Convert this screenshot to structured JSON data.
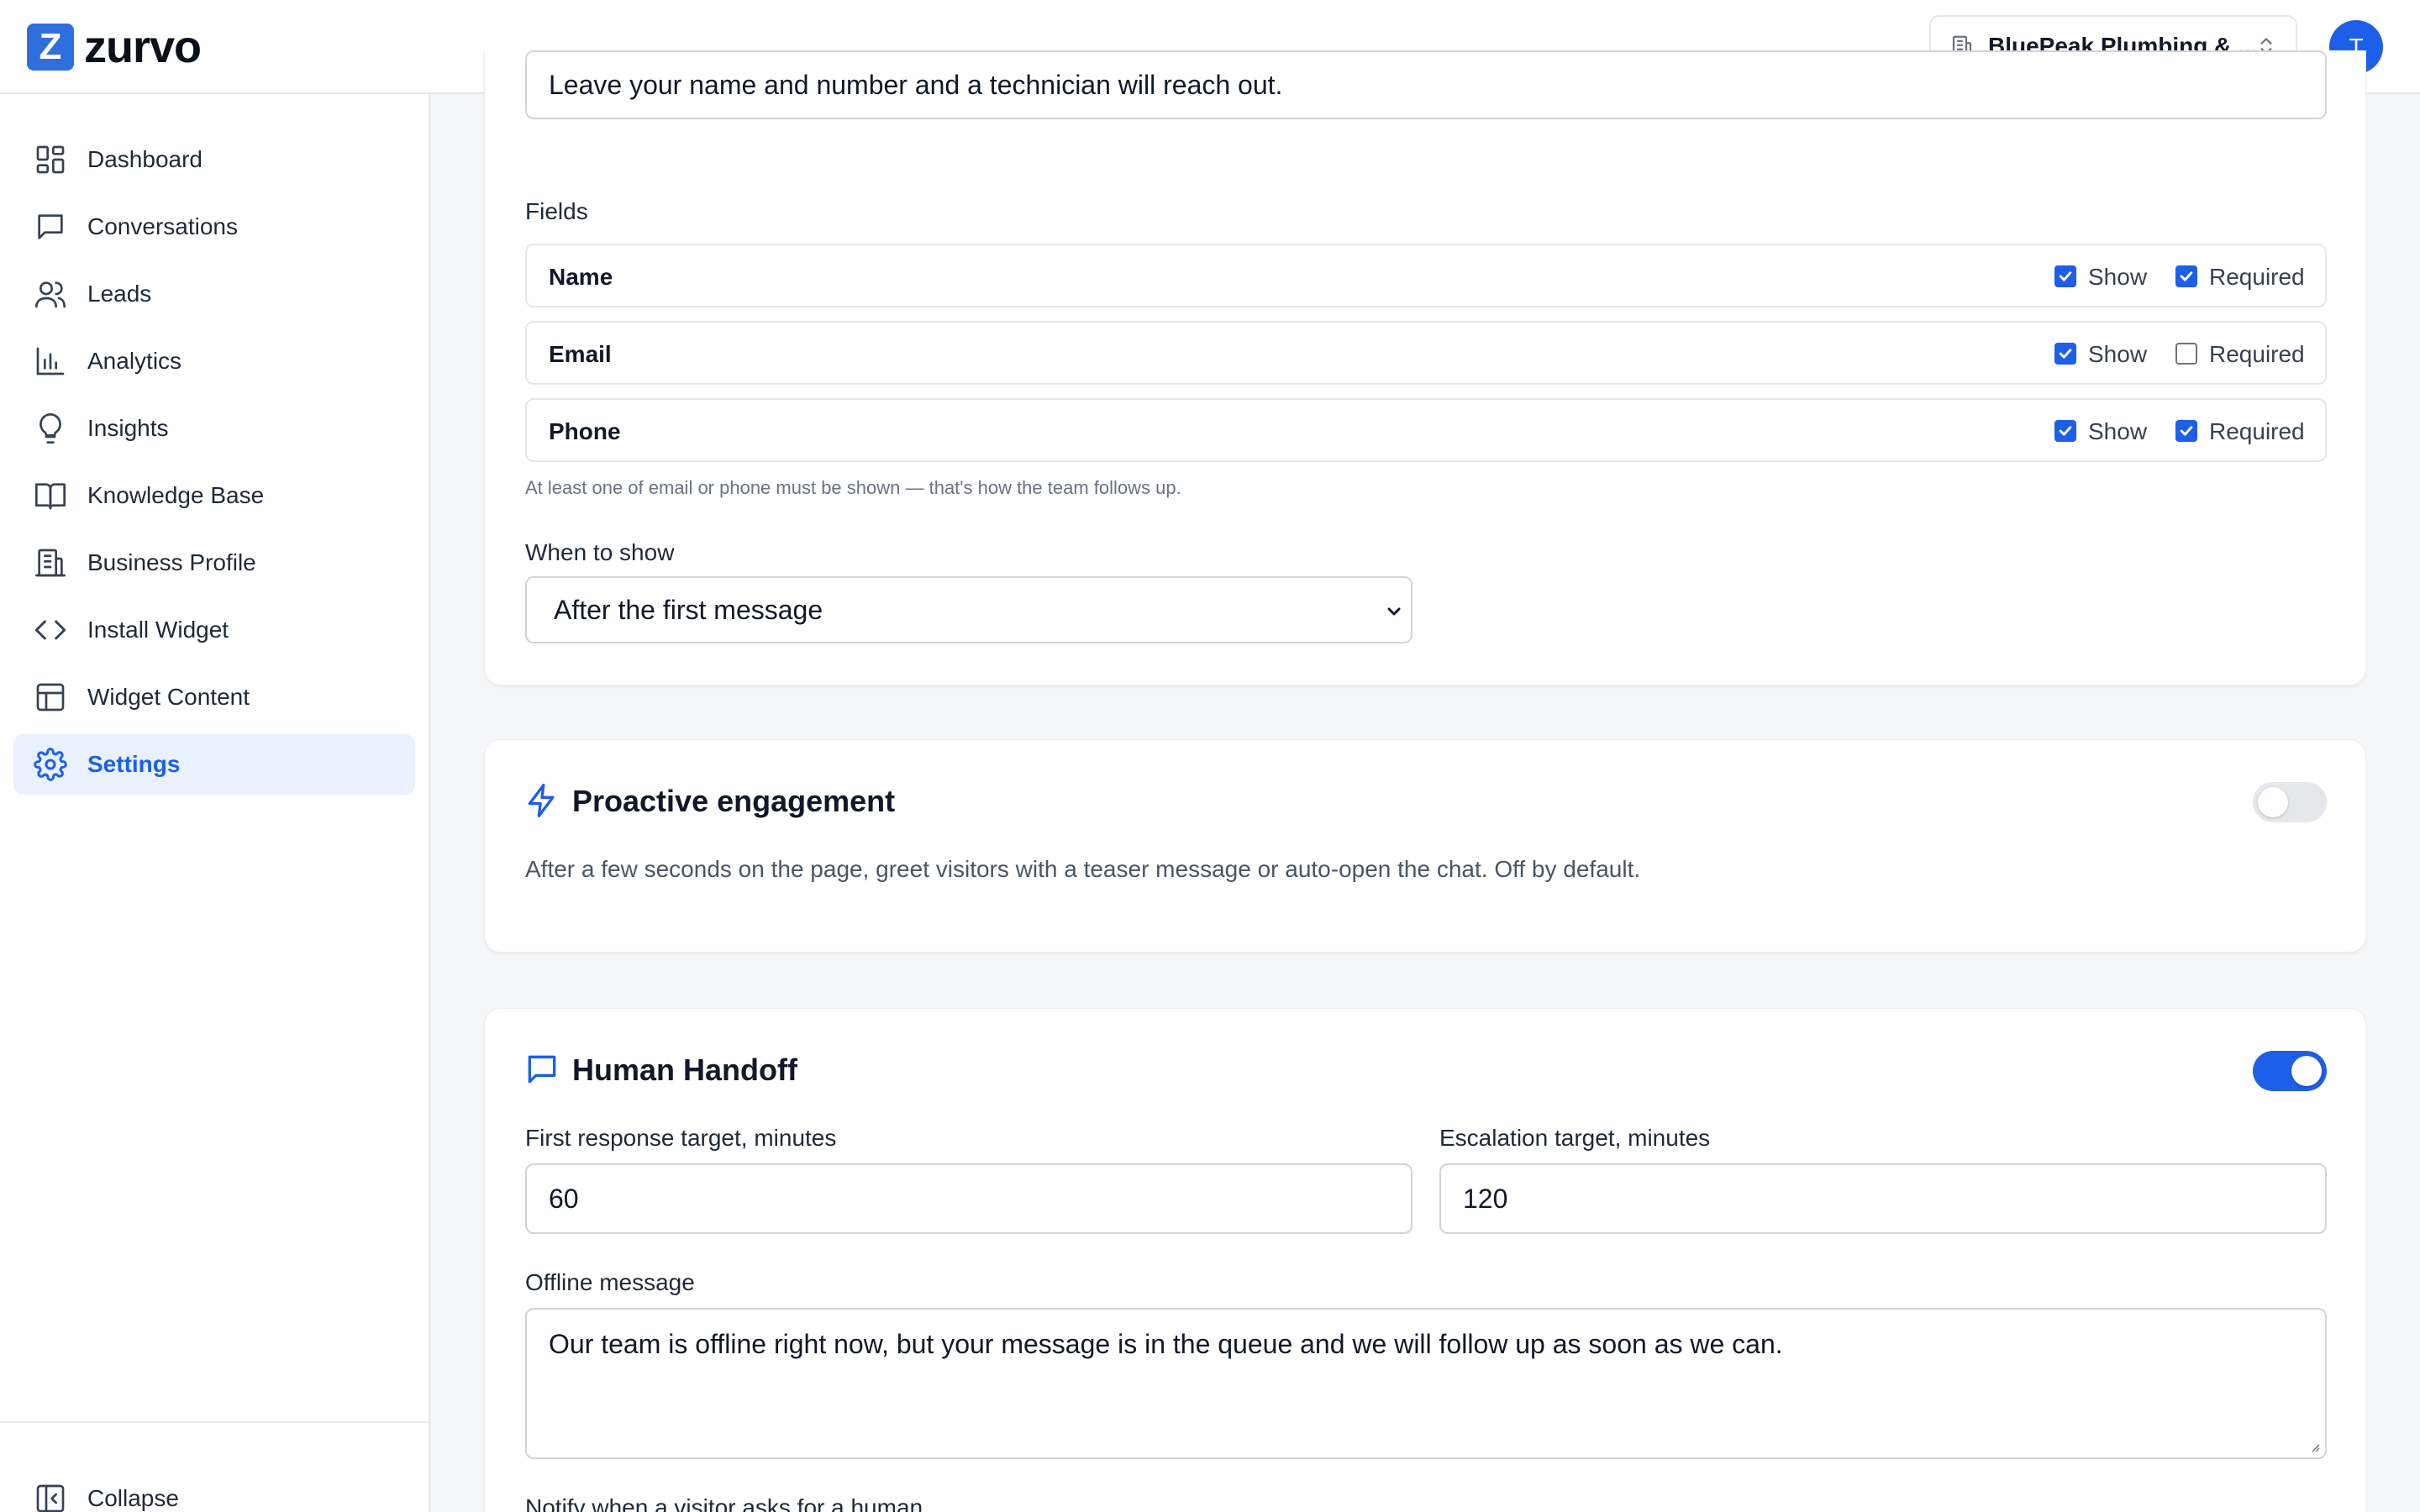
{
  "app": {
    "logo_letter": "Z",
    "logo_name": "zurvo"
  },
  "header": {
    "org_name": "BluePeak Plumbing & ...",
    "avatar_initial": "T"
  },
  "sidebar": {
    "items": [
      {
        "label": "Dashboard",
        "icon": "dashboard-icon"
      },
      {
        "label": "Conversations",
        "icon": "chat-bubble-icon"
      },
      {
        "label": "Leads",
        "icon": "users-icon"
      },
      {
        "label": "Analytics",
        "icon": "bar-chart-icon"
      },
      {
        "label": "Insights",
        "icon": "lightbulb-icon"
      },
      {
        "label": "Knowledge Base",
        "icon": "book-icon"
      },
      {
        "label": "Business Profile",
        "icon": "building-icon"
      },
      {
        "label": "Install Widget",
        "icon": "code-icon"
      },
      {
        "label": "Widget Content",
        "icon": "layout-icon"
      },
      {
        "label": "Settings",
        "icon": "gear-icon",
        "active": true
      }
    ],
    "collapse_label": "Collapse"
  },
  "lead_form": {
    "intro_value": "Leave your name and number and a technician will reach out.",
    "fields_label": "Fields",
    "show_label": "Show",
    "required_label": "Required",
    "fields": [
      {
        "name": "Name",
        "show": true,
        "required": true
      },
      {
        "name": "Email",
        "show": true,
        "required": false
      },
      {
        "name": "Phone",
        "show": true,
        "required": true
      }
    ],
    "hint": "At least one of email or phone must be shown — that's how the team follows up.",
    "when_label": "When to show",
    "when_value": "After the first message"
  },
  "proactive": {
    "title": "Proactive engagement",
    "description": "After a few seconds on the page, greet visitors with a teaser message or auto-open the chat. Off by default.",
    "enabled": false
  },
  "handoff": {
    "title": "Human Handoff",
    "enabled": true,
    "first_response_label": "First response target, minutes",
    "first_response_value": "60",
    "escalation_label": "Escalation target, minutes",
    "escalation_value": "120",
    "offline_label": "Offline message",
    "offline_value": "Our team is offline right now, but your message is in the queue and we will follow up as soon as we can.",
    "notify_label": "Notify when a visitor asks for a human"
  },
  "colors": {
    "accent": "#1d5fe8",
    "logo": "#2f6fdb",
    "active_bg": "#e8f1fd",
    "page_bg": "#f4f6f8"
  }
}
